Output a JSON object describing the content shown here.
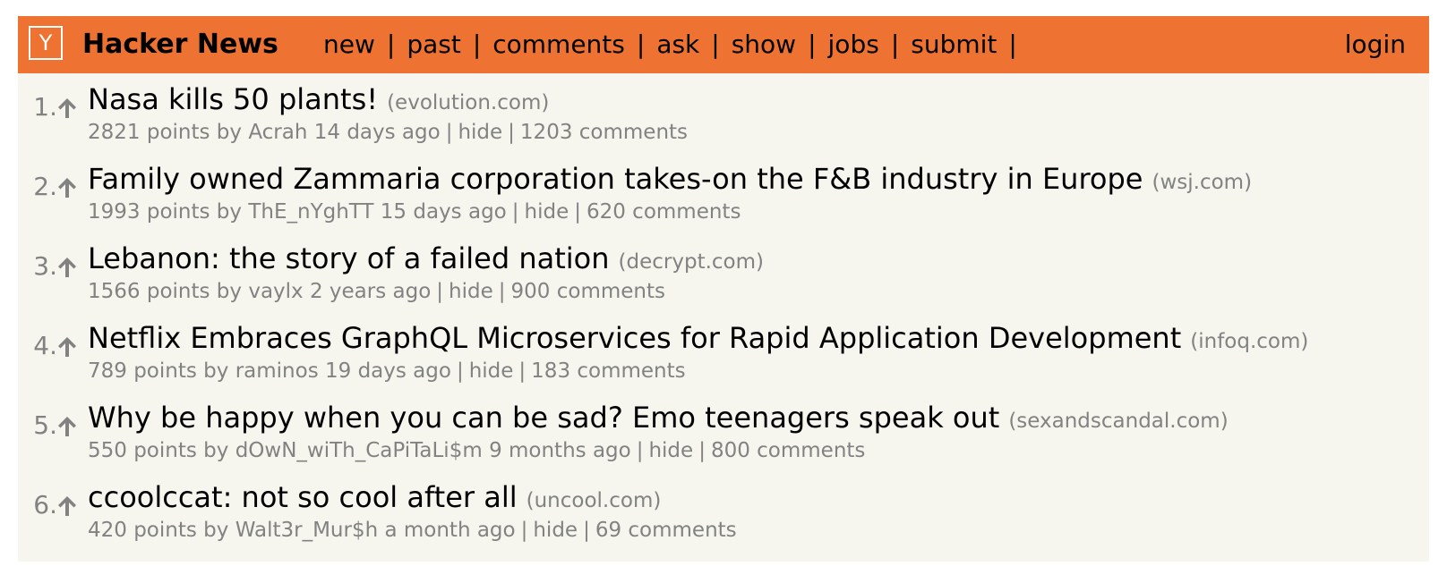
{
  "header": {
    "logo": "Y",
    "site_name": "Hacker News",
    "nav": [
      "new",
      "past",
      "comments",
      "ask",
      "show",
      "jobs",
      "submit"
    ],
    "login": "login",
    "accent_color": "#ee7332",
    "background_color": "#f6f6ef"
  },
  "icons": {
    "vote": "upvote-arrow-icon"
  },
  "stories": [
    {
      "rank": "1.",
      "title": "Nasa kills 50 plants!",
      "site": "(evolution.com)",
      "points": "2821 points",
      "by": "by",
      "user": "Acrah",
      "age": "14 days ago",
      "hide": "hide",
      "comments": "1203 comments"
    },
    {
      "rank": "2.",
      "title": "Family owned Zammaria corporation takes-on the F&B industry in Europe",
      "site": "(wsj.com)",
      "points": "1993 points",
      "by": "by",
      "user": "ThE_nYghTT",
      "age": "15 days ago",
      "hide": "hide",
      "comments": "620 comments"
    },
    {
      "rank": "3.",
      "title": "Lebanon: the story of a failed nation",
      "site": "(decrypt.com)",
      "points": "1566 points",
      "by": "by",
      "user": "vaylx",
      "age": "2 years ago",
      "hide": "hide",
      "comments": "900 comments"
    },
    {
      "rank": "4.",
      "title": "Netflix Embraces GraphQL Microservices for Rapid Application Development",
      "site": "(infoq.com)",
      "points": "789 points",
      "by": "by",
      "user": "raminos",
      "age": "19 days ago",
      "hide": "hide",
      "comments": "183 comments"
    },
    {
      "rank": "5.",
      "title": "Why be happy when you can be sad? Emo teenagers speak out",
      "site": "(sexandscandal.com)",
      "points": "550 points",
      "by": "by",
      "user": "dOwN_wiTh_CaPiTaLi$m",
      "age": "9 months ago",
      "hide": "hide",
      "comments": "800 comments"
    },
    {
      "rank": "6.",
      "title": "ccoolccat: not so cool after all",
      "site": "(uncool.com)",
      "points": "420 points",
      "by": "by",
      "user": "Walt3r_Mur$h",
      "age": "a month ago",
      "hide": "hide",
      "comments": "69 comments"
    }
  ]
}
